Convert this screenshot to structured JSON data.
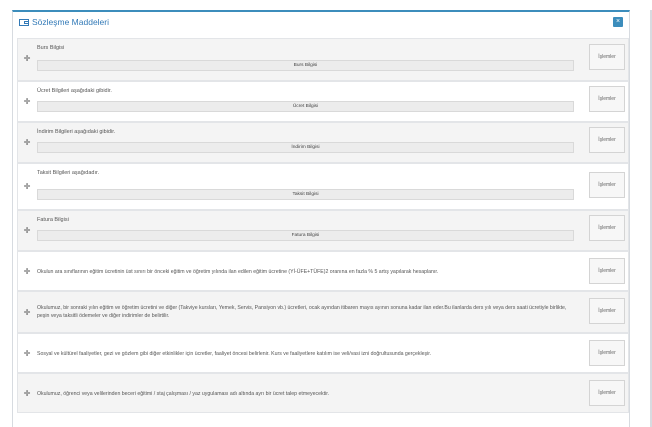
{
  "panel": {
    "title": "Sözleşme Maddeleri",
    "close_label": "×"
  },
  "rows": [
    {
      "label": "Burs Bilgisi",
      "field": "Burs Bilgisi",
      "action": "İşlemler"
    },
    {
      "label": "Ücret Bilgileri aşağıdaki gibidir.",
      "field": "Ücret Bilgisi",
      "action": "İşlemler"
    },
    {
      "label": "İndirim Bilgileri aşağıdaki gibidir.",
      "field": "İndirim Bilgisi",
      "action": "İşlemler"
    },
    {
      "label": "Taksit Bilgileri aşağıdadır.",
      "field": "Taksit Bilgisi",
      "action": "İşlemler"
    },
    {
      "label": "Fatura Bilgisi",
      "field": "Fatura Bilgisi",
      "action": "İşlemler"
    },
    {
      "text": "Okulun ara sınıflarının eğitim ücretinin üst sınırı bir önceki eğitim ve öğretim yılında ilan edilen eğitim ücretine (Yİ-ÜFE+TÜFE)2 oranına en fazla % 5 artış yapılarak hesaplanır.",
      "action": "İşlemler"
    },
    {
      "text": "Okulumuz, bir sonraki yılın eğitim ve öğretim ücretini ve diğer (Takviye kursları, Yemek, Servis, Pansiyon vb.) ücretleri, ocak ayından itibaren mayıs ayının sonuna kadar ilan eder.Bu ilanlarda ders yılı veya ders saati ücretiyle birlikte, peşin veya taksitli ödemeler ve diğer indirimler de belirtilir.",
      "action": "İşlemler"
    },
    {
      "text": "Sosyal ve kültürel faaliyetler, gezi ve gözlem gibi diğer etkinlikler için ücretler, faaliyet öncesi belirlenir. Kurs ve faaliyetlere katılım ise veli/vasi izni doğrultusunda gerçekleşir.",
      "action": "İşlemler"
    },
    {
      "text": "Okulumuz, öğrenci veya velilerinden beceri eğitimi / staj çalışması / yaz uygulaması adı altında ayrı bir ücret talep etmeyecektir.",
      "action": "İşlemler"
    }
  ]
}
